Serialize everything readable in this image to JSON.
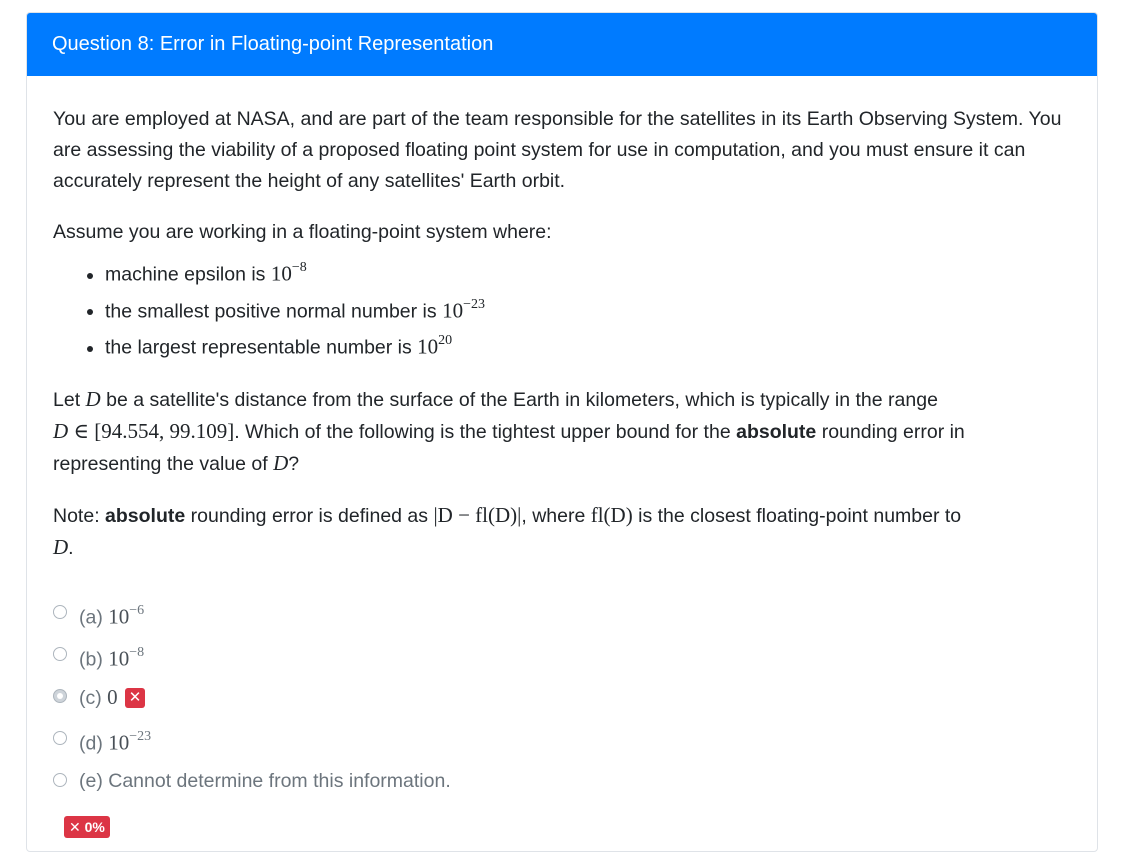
{
  "question": {
    "title": "Question 8: Error in Floating-point Representation",
    "para1": "You are employed at NASA, and are part of the team responsible for the satellites in its Earth Observing System. You are assessing the viability of a proposed floating point system for use in computation, and you must ensure it can accurately represent the height of any satellites' Earth orbit.",
    "para2": "Assume you are working in a floating-point system where:",
    "bullets": [
      {
        "text": "machine epsilon is ",
        "base": "10",
        "exp": "−8"
      },
      {
        "text": "the smallest positive normal number is ",
        "base": "10",
        "exp": "−23"
      },
      {
        "text": "the largest representable number is ",
        "base": "10",
        "exp": "20"
      }
    ],
    "para3": {
      "t1": "Let ",
      "var": "D",
      "t2": " be a satellite's distance from the surface of the Earth in kilometers, which is typically in the range",
      "range": " ∈ [94.554, 99.109]",
      "t3": ". Which of the following is the tightest upper bound for the ",
      "bold": "absolute",
      "t4": " rounding error in representing the value of ",
      "t5": "?"
    },
    "note": {
      "t1": "Note: ",
      "bold": "absolute",
      "t2": " rounding error is defined as ",
      "expr1": "|D − fl(D)|",
      "t3": ", where ",
      "expr2": "fl(D)",
      "t4": " is the closest floating-point number to",
      "var": "D",
      "t5": "."
    }
  },
  "options": [
    {
      "label": "(a) ",
      "base": "10",
      "exp": "−6"
    },
    {
      "label": "(b) ",
      "base": "10",
      "exp": "−8"
    },
    {
      "label": "(c) ",
      "value": "0",
      "mark": "✕"
    },
    {
      "label": "(d) ",
      "base": "10",
      "exp": "−23"
    },
    {
      "label": "(e) Cannot determine from this information."
    }
  ],
  "score": "✕ 0%",
  "colors": {
    "header": "#007bff",
    "incorrect": "#dc3545"
  }
}
